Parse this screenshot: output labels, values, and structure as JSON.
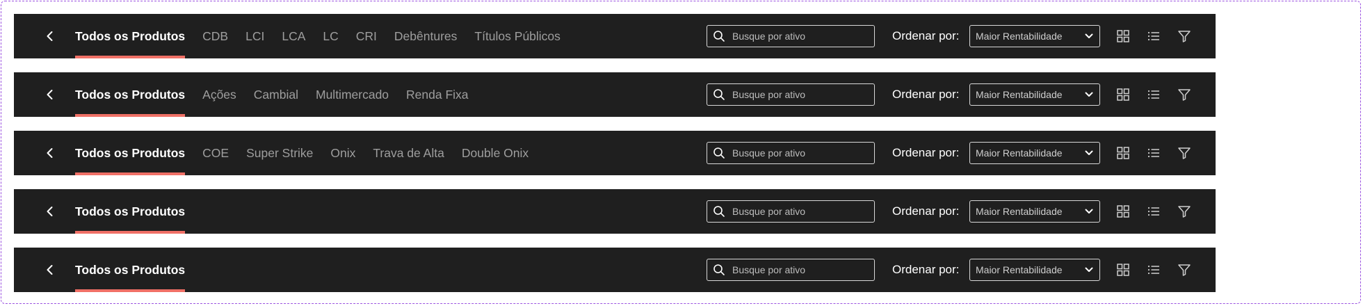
{
  "toolbars": [
    {
      "tabs": [
        {
          "label": "Todos os Produtos",
          "active": true
        },
        {
          "label": "CDB",
          "active": false
        },
        {
          "label": "LCI",
          "active": false
        },
        {
          "label": "LCA",
          "active": false
        },
        {
          "label": "LC",
          "active": false
        },
        {
          "label": "CRI",
          "active": false
        },
        {
          "label": "Debêntures",
          "active": false
        },
        {
          "label": "Títulos Públicos",
          "active": false
        }
      ],
      "search": {
        "placeholder": "Busque por ativo",
        "value": ""
      },
      "sort": {
        "label": "Ordenar por:",
        "selected": "Maior Rentabilidade"
      },
      "icons": {
        "back": "chevron-left-icon",
        "grid": "grid-view-icon",
        "list": "list-view-icon",
        "filter": "filter-icon",
        "search": "search-icon",
        "dropdown": "chevron-down-icon"
      }
    },
    {
      "tabs": [
        {
          "label": "Todos os Produtos",
          "active": true
        },
        {
          "label": "Ações",
          "active": false
        },
        {
          "label": "Cambial",
          "active": false
        },
        {
          "label": "Multimercado",
          "active": false
        },
        {
          "label": "Renda Fixa",
          "active": false
        }
      ],
      "search": {
        "placeholder": "Busque por ativo",
        "value": ""
      },
      "sort": {
        "label": "Ordenar por:",
        "selected": "Maior Rentabilidade"
      },
      "icons": {
        "back": "chevron-left-icon",
        "grid": "grid-view-icon",
        "list": "list-view-icon",
        "filter": "filter-icon",
        "search": "search-icon",
        "dropdown": "chevron-down-icon"
      }
    },
    {
      "tabs": [
        {
          "label": "Todos os Produtos",
          "active": true
        },
        {
          "label": "COE",
          "active": false
        },
        {
          "label": "Super Strike",
          "active": false
        },
        {
          "label": "Onix",
          "active": false
        },
        {
          "label": "Trava de Alta",
          "active": false
        },
        {
          "label": "Double Onix",
          "active": false
        }
      ],
      "search": {
        "placeholder": "Busque por ativo",
        "value": ""
      },
      "sort": {
        "label": "Ordenar por:",
        "selected": "Maior Rentabilidade"
      },
      "icons": {
        "back": "chevron-left-icon",
        "grid": "grid-view-icon",
        "list": "list-view-icon",
        "filter": "filter-icon",
        "search": "search-icon",
        "dropdown": "chevron-down-icon"
      }
    },
    {
      "tabs": [
        {
          "label": "Todos os Produtos",
          "active": true
        }
      ],
      "search": {
        "placeholder": "Busque por ativo",
        "value": ""
      },
      "sort": {
        "label": "Ordenar por:",
        "selected": "Maior Rentabilidade"
      },
      "icons": {
        "back": "chevron-left-icon",
        "grid": "grid-view-icon",
        "list": "list-view-icon",
        "filter": "filter-icon",
        "search": "search-icon",
        "dropdown": "chevron-down-icon"
      }
    },
    {
      "tabs": [
        {
          "label": "Todos os Produtos",
          "active": true
        }
      ],
      "search": {
        "placeholder": "Busque por ativo",
        "value": ""
      },
      "sort": {
        "label": "Ordenar por:",
        "selected": "Maior Rentabilidade"
      },
      "icons": {
        "back": "chevron-left-icon",
        "grid": "grid-view-icon",
        "list": "list-view-icon",
        "filter": "filter-icon",
        "search": "search-icon",
        "dropdown": "chevron-down-icon"
      }
    }
  ],
  "colors": {
    "bar_background": "#1f1f1f",
    "active_tab_text": "#ffffff",
    "inactive_tab_text": "#9e9e9e",
    "active_tab_underline": "#f07066",
    "frame_border": "#9b51e0"
  }
}
